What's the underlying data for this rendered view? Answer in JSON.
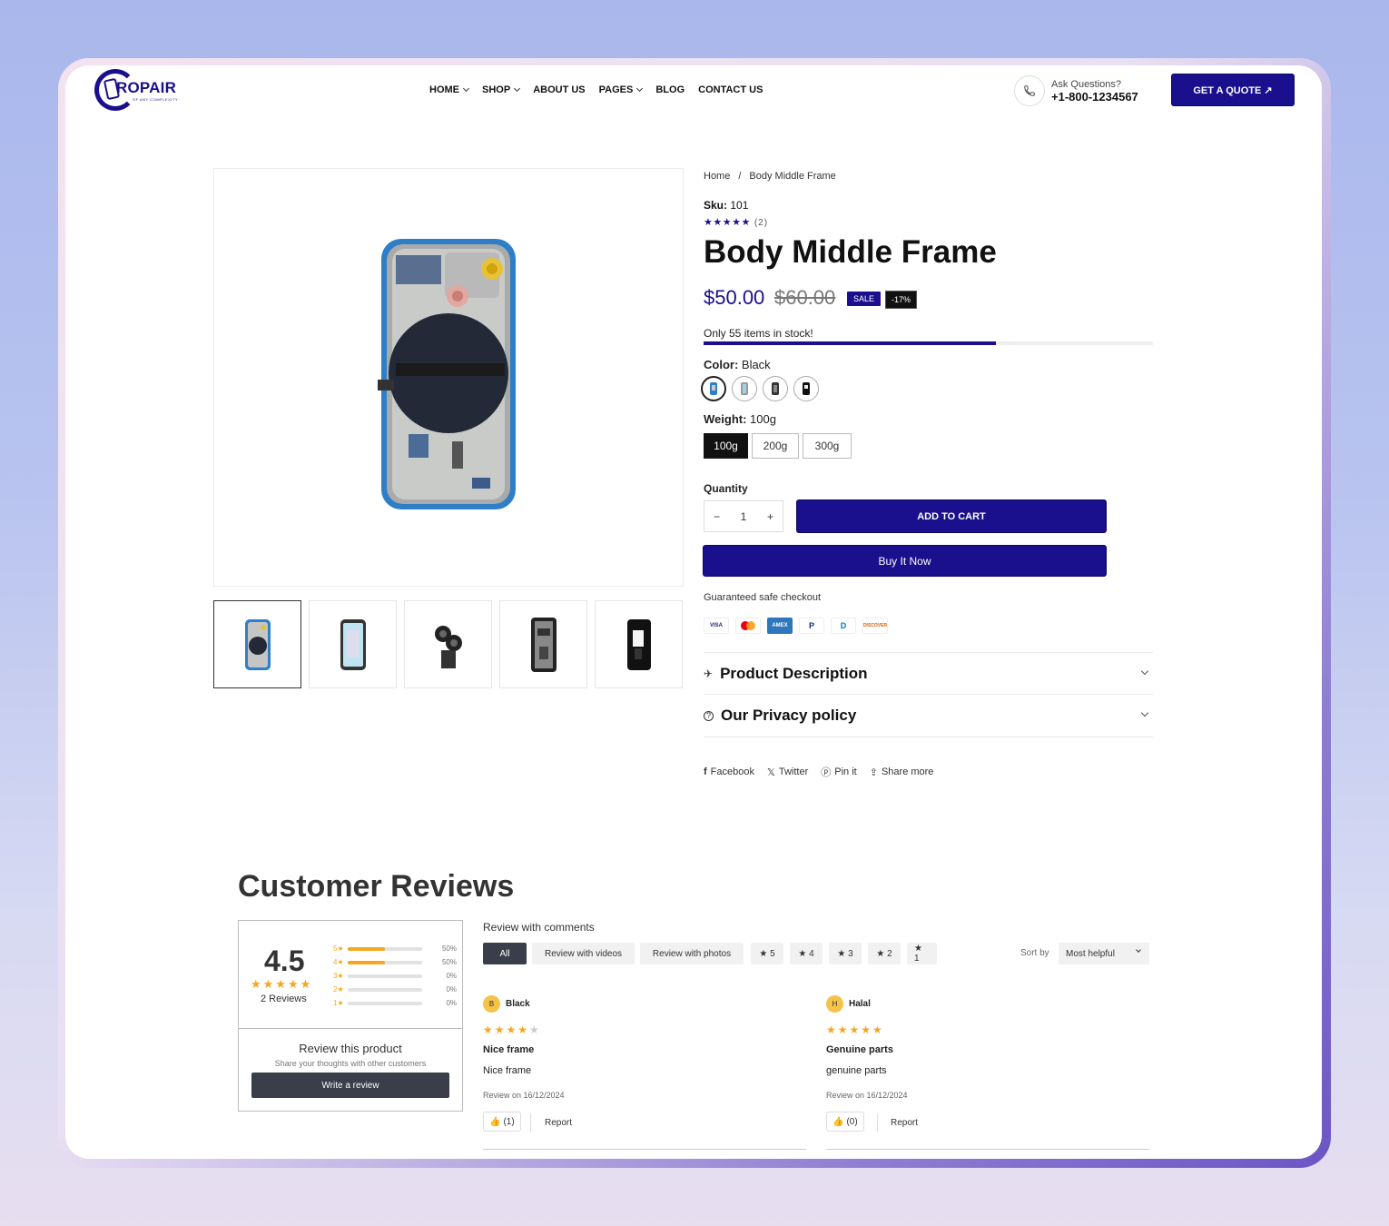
{
  "brand": {
    "logo_text": "ROPAIR",
    "logo_sub": "OF ANY COMPLEXITY"
  },
  "nav": [
    {
      "label": "HOME",
      "dropdown": true
    },
    {
      "label": "SHOP",
      "dropdown": true
    },
    {
      "label": "ABOUT US",
      "dropdown": false
    },
    {
      "label": "PAGES",
      "dropdown": true
    },
    {
      "label": "BLOG",
      "dropdown": false
    },
    {
      "label": "CONTACT US",
      "dropdown": false
    }
  ],
  "header": {
    "ask": "Ask Questions?",
    "phone": "+1-800-1234567",
    "quote_btn": "GET A QUOTE ↗"
  },
  "breadcrumb": {
    "home": "Home",
    "sep": "/",
    "current": "Body Middle Frame"
  },
  "product": {
    "sku_label": "Sku:",
    "sku": " 101",
    "rating_stars": "★★★★★",
    "rating_count": "(2)",
    "title": "Body Middle Frame",
    "price": "$50.00",
    "compare_price": "$60.00",
    "sale_badge": "SALE",
    "discount_badge": "-17%",
    "stock_text": "Only 55 items in stock!",
    "stock_level": 0.65,
    "color_label": "Color:",
    "color_value": " Black",
    "weight_label": "Weight:",
    "weight_value": " 100g",
    "weights": [
      "100g",
      "200g",
      "300g"
    ],
    "quantity_label": "Quantity",
    "quantity": "1",
    "minus": "−",
    "plus": "+",
    "add_to_cart": "ADD TO CART",
    "buy_now": "Buy It Now",
    "safe_checkout": "Guaranteed safe checkout",
    "payments": [
      "VISA",
      "MC",
      "AMEX",
      "P",
      "D",
      "DISCOVER"
    ],
    "accordion": [
      {
        "icon": "plane-icon",
        "glyph": "✈",
        "title": "Product Description"
      },
      {
        "icon": "question-icon",
        "glyph": "?",
        "title": "Our Privacy policy"
      }
    ],
    "share": [
      {
        "glyph": "f",
        "label": "Facebook"
      },
      {
        "glyph": "𝕏",
        "label": "Twitter"
      },
      {
        "glyph": "ⓟ",
        "label": "Pin it"
      },
      {
        "glyph": "⇪",
        "label": "Share more"
      }
    ]
  },
  "reviews": {
    "heading": "Customer Reviews",
    "average": "4.5",
    "average_stars": "★★★★★",
    "count_text": "2 Reviews",
    "breakdown": [
      {
        "star": "5",
        "percent": 50,
        "label": "50%"
      },
      {
        "star": "4",
        "percent": 50,
        "label": "50%"
      },
      {
        "star": "3",
        "percent": 0,
        "label": "0%"
      },
      {
        "star": "2",
        "percent": 0,
        "label": "0%"
      },
      {
        "star": "1",
        "percent": 0,
        "label": "0%"
      }
    ],
    "review_product_title": "Review this product",
    "review_product_sub": "Share your thoughts with other customers",
    "write_review": "Write a review",
    "with_comments": "Review with comments",
    "filters": [
      "All",
      "Review with videos",
      "Review with photos",
      "★ 5",
      "★ 4",
      "★ 3",
      "★ 2",
      "★ 1"
    ],
    "sort_label": "Sort by",
    "sort_value": "Most helpful",
    "items": [
      {
        "initial": "B",
        "name": "Black",
        "stars": "★★★★",
        "stars_off": "★",
        "title": "Nice frame",
        "body": "Nice frame",
        "date": "Review on 16/12/2024",
        "helpful": "(1)",
        "report": "Report"
      },
      {
        "initial": "H",
        "name": "Halal",
        "stars": "★★★★★",
        "stars_off": "",
        "title": "Genuine parts",
        "body": "genuine parts",
        "date": "Review on 16/12/2024",
        "helpful": "(0)",
        "report": "Report"
      }
    ]
  },
  "colors": {
    "brand": "#1a0f8c",
    "star": "#f5a623",
    "dark": "#3a3d4a"
  }
}
